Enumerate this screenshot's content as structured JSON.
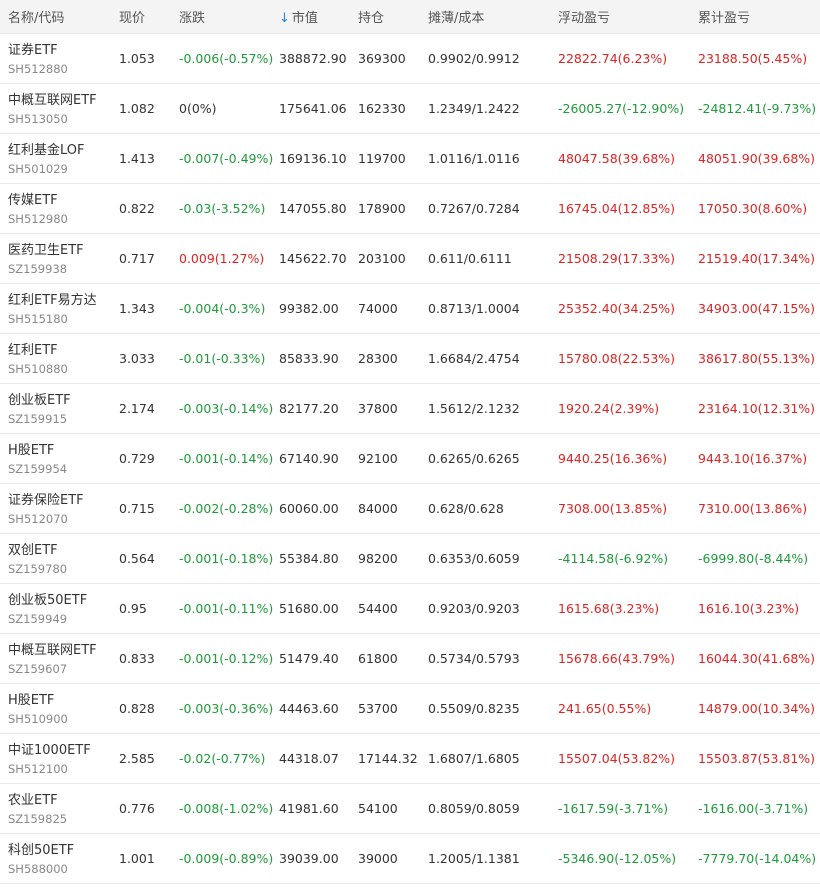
{
  "header": {
    "name_code": "名称/代码",
    "price": "现价",
    "change": "涨跌",
    "market_value_arrow": "↓",
    "market_value": "市值",
    "position": "持仓",
    "cost": "摊薄/成本",
    "floating_pl": "浮动盈亏",
    "cumulative_pl": "累计盈亏"
  },
  "rows": [
    {
      "name": "证券ETF",
      "code": "SH512880",
      "price": "1.053",
      "change": "-0.006(-0.57%)",
      "change_dir": "down",
      "mv": "388872.90",
      "pos": "369300",
      "cost": "0.9902/0.9912",
      "float_pl": "22822.74(6.23%)",
      "float_dir": "up",
      "cum_pl": "23188.50(5.45%)",
      "cum_dir": "up"
    },
    {
      "name": "中概互联网ETF",
      "code": "SH513050",
      "price": "1.082",
      "change": "0(0%)",
      "change_dir": "flat",
      "mv": "175641.06",
      "pos": "162330",
      "cost": "1.2349/1.2422",
      "float_pl": "-26005.27(-12.90%)",
      "float_dir": "down",
      "cum_pl": "-24812.41(-9.73%)",
      "cum_dir": "down"
    },
    {
      "name": "红利基金LOF",
      "code": "SH501029",
      "price": "1.413",
      "change": "-0.007(-0.49%)",
      "change_dir": "down",
      "mv": "169136.10",
      "pos": "119700",
      "cost": "1.0116/1.0116",
      "float_pl": "48047.58(39.68%)",
      "float_dir": "up",
      "cum_pl": "48051.90(39.68%)",
      "cum_dir": "up"
    },
    {
      "name": "传媒ETF",
      "code": "SH512980",
      "price": "0.822",
      "change": "-0.03(-3.52%)",
      "change_dir": "down",
      "mv": "147055.80",
      "pos": "178900",
      "cost": "0.7267/0.7284",
      "float_pl": "16745.04(12.85%)",
      "float_dir": "up",
      "cum_pl": "17050.30(8.60%)",
      "cum_dir": "up"
    },
    {
      "name": "医药卫生ETF",
      "code": "SZ159938",
      "price": "0.717",
      "change": "0.009(1.27%)",
      "change_dir": "up",
      "mv": "145622.70",
      "pos": "203100",
      "cost": "0.611/0.6111",
      "float_pl": "21508.29(17.33%)",
      "float_dir": "up",
      "cum_pl": "21519.40(17.34%)",
      "cum_dir": "up"
    },
    {
      "name": "红利ETF易方达",
      "code": "SH515180",
      "price": "1.343",
      "change": "-0.004(-0.3%)",
      "change_dir": "down",
      "mv": "99382.00",
      "pos": "74000",
      "cost": "0.8713/1.0004",
      "float_pl": "25352.40(34.25%)",
      "float_dir": "up",
      "cum_pl": "34903.00(47.15%)",
      "cum_dir": "up"
    },
    {
      "name": "红利ETF",
      "code": "SH510880",
      "price": "3.033",
      "change": "-0.01(-0.33%)",
      "change_dir": "down",
      "mv": "85833.90",
      "pos": "28300",
      "cost": "1.6684/2.4754",
      "float_pl": "15780.08(22.53%)",
      "float_dir": "up",
      "cum_pl": "38617.80(55.13%)",
      "cum_dir": "up"
    },
    {
      "name": "创业板ETF",
      "code": "SZ159915",
      "price": "2.174",
      "change": "-0.003(-0.14%)",
      "change_dir": "down",
      "mv": "82177.20",
      "pos": "37800",
      "cost": "1.5612/2.1232",
      "float_pl": "1920.24(2.39%)",
      "float_dir": "up",
      "cum_pl": "23164.10(12.31%)",
      "cum_dir": "up"
    },
    {
      "name": "H股ETF",
      "code": "SZ159954",
      "price": "0.729",
      "change": "-0.001(-0.14%)",
      "change_dir": "down",
      "mv": "67140.90",
      "pos": "92100",
      "cost": "0.6265/0.6265",
      "float_pl": "9440.25(16.36%)",
      "float_dir": "up",
      "cum_pl": "9443.10(16.37%)",
      "cum_dir": "up"
    },
    {
      "name": "证券保险ETF",
      "code": "SH512070",
      "price": "0.715",
      "change": "-0.002(-0.28%)",
      "change_dir": "down",
      "mv": "60060.00",
      "pos": "84000",
      "cost": "0.628/0.628",
      "float_pl": "7308.00(13.85%)",
      "float_dir": "up",
      "cum_pl": "7310.00(13.86%)",
      "cum_dir": "up"
    },
    {
      "name": "双创ETF",
      "code": "SZ159780",
      "price": "0.564",
      "change": "-0.001(-0.18%)",
      "change_dir": "down",
      "mv": "55384.80",
      "pos": "98200",
      "cost": "0.6353/0.6059",
      "float_pl": "-4114.58(-6.92%)",
      "float_dir": "down",
      "cum_pl": "-6999.80(-8.44%)",
      "cum_dir": "down"
    },
    {
      "name": "创业板50ETF",
      "code": "SZ159949",
      "price": "0.95",
      "change": "-0.001(-0.11%)",
      "change_dir": "down",
      "mv": "51680.00",
      "pos": "54400",
      "cost": "0.9203/0.9203",
      "float_pl": "1615.68(3.23%)",
      "float_dir": "up",
      "cum_pl": "1616.10(3.23%)",
      "cum_dir": "up"
    },
    {
      "name": "中概互联网ETF",
      "code": "SZ159607",
      "price": "0.833",
      "change": "-0.001(-0.12%)",
      "change_dir": "down",
      "mv": "51479.40",
      "pos": "61800",
      "cost": "0.5734/0.5793",
      "float_pl": "15678.66(43.79%)",
      "float_dir": "up",
      "cum_pl": "16044.30(41.68%)",
      "cum_dir": "up"
    },
    {
      "name": "H股ETF",
      "code": "SH510900",
      "price": "0.828",
      "change": "-0.003(-0.36%)",
      "change_dir": "down",
      "mv": "44463.60",
      "pos": "53700",
      "cost": "0.5509/0.8235",
      "float_pl": "241.65(0.55%)",
      "float_dir": "up",
      "cum_pl": "14879.00(10.34%)",
      "cum_dir": "up"
    },
    {
      "name": "中证1000ETF",
      "code": "SH512100",
      "price": "2.585",
      "change": "-0.02(-0.77%)",
      "change_dir": "down",
      "mv": "44318.07",
      "pos": "17144.32",
      "cost": "1.6807/1.6805",
      "float_pl": "15507.04(53.82%)",
      "float_dir": "up",
      "cum_pl": "15503.87(53.81%)",
      "cum_dir": "up"
    },
    {
      "name": "农业ETF",
      "code": "SZ159825",
      "price": "0.776",
      "change": "-0.008(-1.02%)",
      "change_dir": "down",
      "mv": "41981.60",
      "pos": "54100",
      "cost": "0.8059/0.8059",
      "float_pl": "-1617.59(-3.71%)",
      "float_dir": "down",
      "cum_pl": "-1616.00(-3.71%)",
      "cum_dir": "down"
    },
    {
      "name": "科创50ETF",
      "code": "SH588000",
      "price": "1.001",
      "change": "-0.009(-0.89%)",
      "change_dir": "down",
      "mv": "39039.00",
      "pos": "39000",
      "cost": "1.2005/1.1381",
      "float_pl": "-5346.90(-12.05%)",
      "float_dir": "down",
      "cum_pl": "-7779.70(-14.04%)",
      "cum_dir": "down"
    }
  ],
  "colors": {
    "up": "#e02222",
    "down": "#1f9a3b",
    "sort_arrow": "#2f7fd8"
  }
}
